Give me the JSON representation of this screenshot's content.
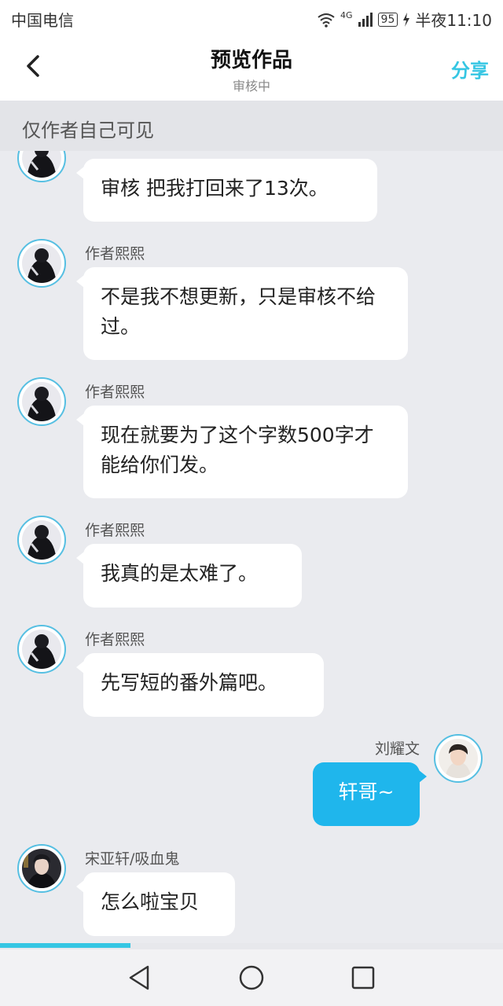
{
  "status_bar": {
    "carrier": "中国电信",
    "network": "4G",
    "battery": "95",
    "time": "半夜11:10"
  },
  "header": {
    "title": "预览作品",
    "subtitle": "审核中",
    "share_label": "分享"
  },
  "notice": {
    "text": "仅作者自己可见"
  },
  "messages": [
    {
      "sender": "",
      "text": "审核 把我打回来了13次。",
      "side": "left"
    },
    {
      "sender": "作者熙熙",
      "text": "不是我不想更新，只是审核不给过。",
      "side": "left"
    },
    {
      "sender": "作者熙熙",
      "text": "现在就要为了这个字数500字才能给你们发。",
      "side": "left"
    },
    {
      "sender": "作者熙熙",
      "text": "我真的是太难了。",
      "side": "left"
    },
    {
      "sender": "作者熙熙",
      "text": "先写短的番外篇吧。",
      "side": "left"
    },
    {
      "sender": "刘耀文",
      "text": "轩哥~",
      "side": "right"
    },
    {
      "sender": "宋亚轩/吸血鬼",
      "text": "怎么啦宝贝",
      "side": "left"
    }
  ],
  "reading_progress": 0.26,
  "colors": {
    "accent": "#35c6e3",
    "bubble_blue": "#1fb6ec",
    "avatar_ring": "#56bfe2"
  }
}
